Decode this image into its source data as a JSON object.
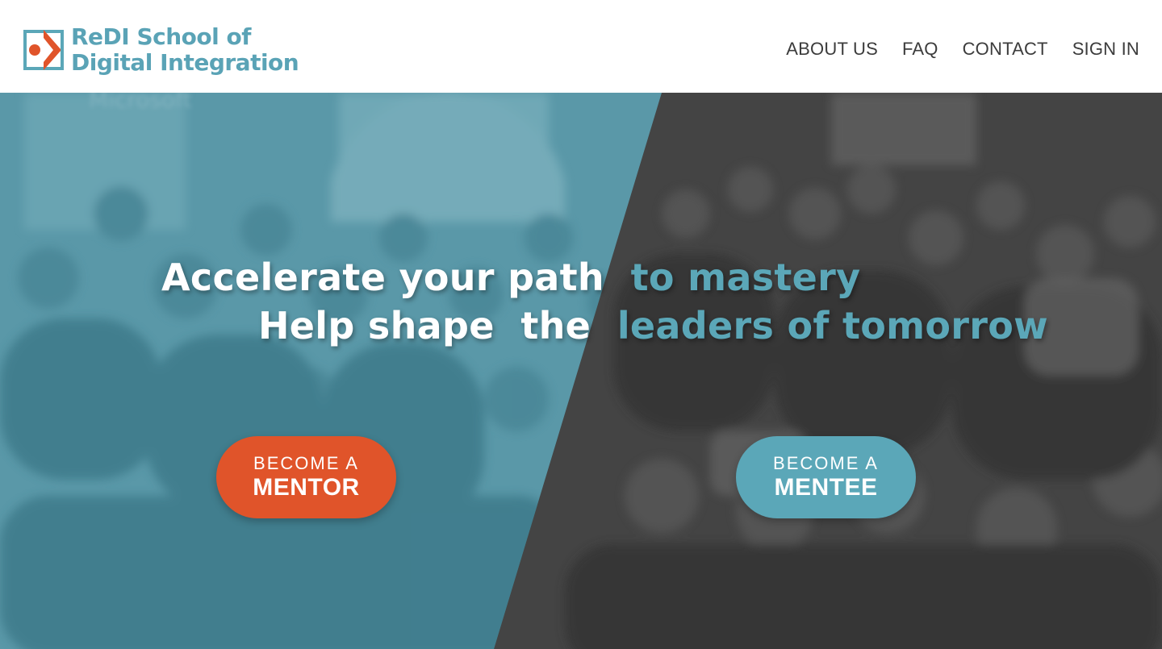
{
  "header": {
    "logo": {
      "line1": "ReDI School of",
      "line2": "Digital Integration"
    },
    "nav": [
      {
        "label": "ABOUT US"
      },
      {
        "label": "FAQ"
      },
      {
        "label": "CONTACT"
      },
      {
        "label": "SIGN IN"
      }
    ]
  },
  "hero": {
    "headline_line1": {
      "white": "Accelerate your path",
      "accent": "to mastery"
    },
    "headline_line2": {
      "white_a": "Help shape",
      "white_b": "the",
      "accent": "leaders of tomorrow"
    },
    "mentor_button": {
      "small": "BECOME  A",
      "big": "MENTOR"
    },
    "mentee_button": {
      "small": "BECOME  A",
      "big": "MENTEE"
    }
  },
  "colors": {
    "brand_teal": "#5ba7b8",
    "brand_orange": "#e0542a",
    "nav_text": "#3c3c3c",
    "overlay_teal": "#5795a4",
    "overlay_dark": "#3f3f3f"
  }
}
